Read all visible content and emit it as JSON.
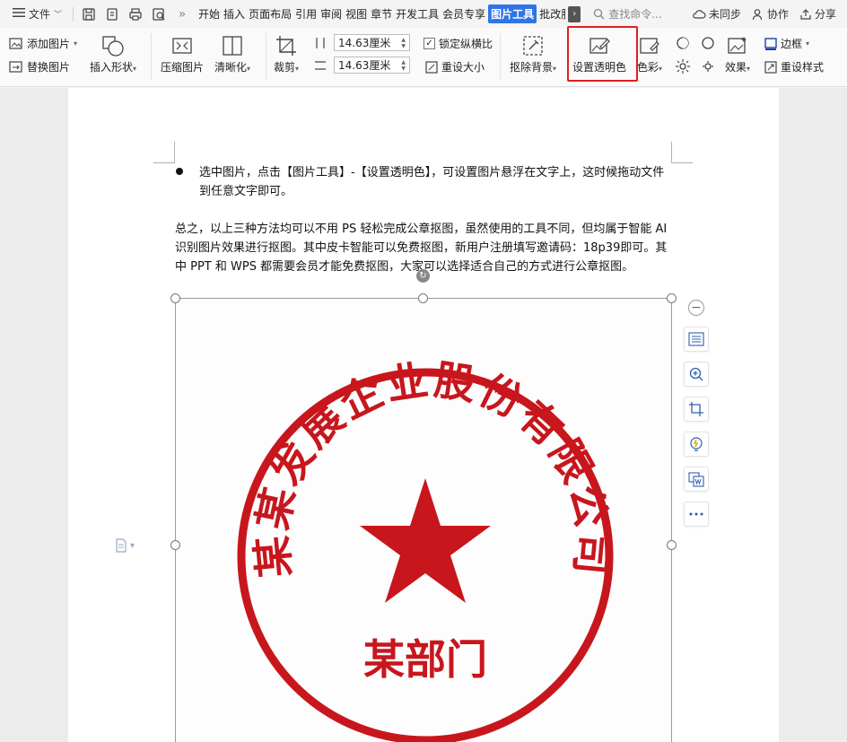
{
  "topbar": {
    "menu_label": "文件",
    "tabs": [
      "开始",
      "插入",
      "页面布局",
      "引用",
      "审阅",
      "视图",
      "章节",
      "开发工具",
      "会员专享",
      "图片工具",
      "批改服"
    ],
    "active_tab": "图片工具",
    "search_placeholder": "查找命令...",
    "sync_label": "未同步",
    "collab_label": "协作",
    "share_label": "分享"
  },
  "ribbon": {
    "add_picture": "添加图片",
    "replace_picture": "替换图片",
    "insert_shape": "插入形状",
    "compress_picture": "压缩图片",
    "sharpen": "清晰化",
    "crop": "裁剪",
    "height_value": "14.63厘米",
    "width_value": "14.63厘米",
    "lock_ratio": "锁定纵横比",
    "reset_size": "重设大小",
    "remove_bg": "抠除背景",
    "set_transparent": "设置透明色",
    "color": "色彩",
    "effects": "效果",
    "border": "边框",
    "reset_style": "重设样式"
  },
  "document": {
    "bullet_text": "选中图片，点击【图片工具】-【设置透明色】，可设置图片悬浮在文字上，这时候拖动文件到任意文字即可。",
    "paragraph": "总之，以上三种方法均可以不用 PS 轻松完成公章抠图，虽然使用的工具不同，但均属于智能 AI 识别图片效果进行抠图。其中皮卡智能可以免费抠图，新用户注册填写邀请码：18p39即可。其中 PPT 和 WPS 都需要会员才能免费抠图，大家可以选择适合自己的方式进行公章抠图。"
  },
  "seal": {
    "ring_text": "某某发展企业股份有限公司",
    "dept_text": "某部门",
    "color": "#c8161d"
  },
  "colors": {
    "accent": "#2f75e6",
    "highlight": "#e0201c"
  }
}
